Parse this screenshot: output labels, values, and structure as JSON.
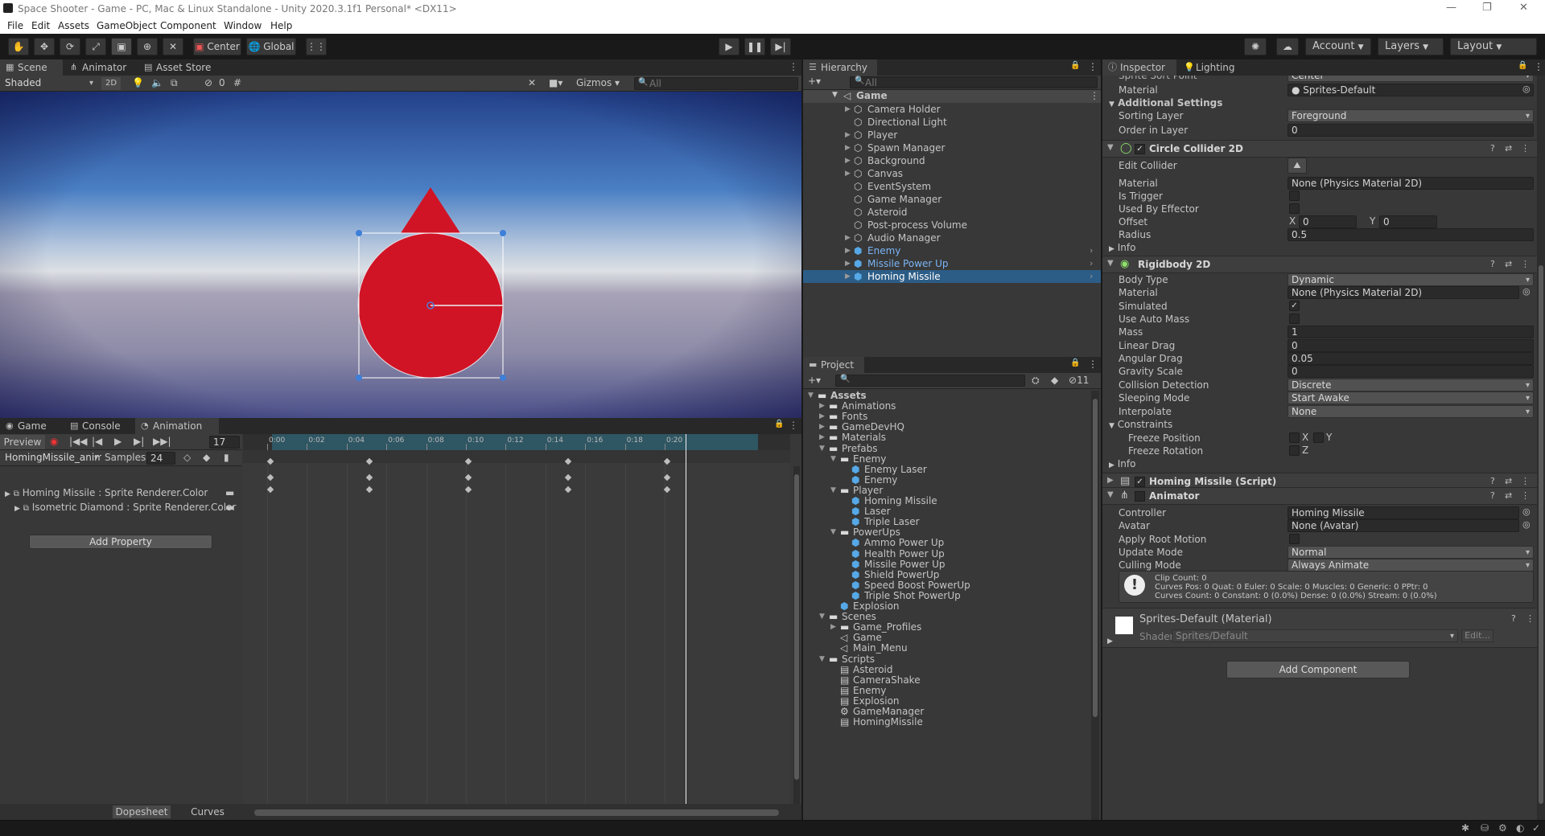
{
  "window": {
    "title": "Space Shooter - Game - PC, Mac & Linux Standalone - Unity 2020.3.1f1 Personal* <DX11>"
  },
  "menu": [
    "File",
    "Edit",
    "Assets",
    "GameObject",
    "Component",
    "Window",
    "Help"
  ],
  "toolbar": {
    "center": "Center",
    "global": "Global",
    "account": "Account",
    "layers": "Layers",
    "layout": "Layout"
  },
  "scene": {
    "tabs": [
      "Scene",
      "Animator",
      "Asset Store"
    ],
    "shading": "Shaded",
    "mode2d": "2D",
    "hidden_count": "0",
    "gizmos": "Gizmos",
    "search_placeholder": "All"
  },
  "bottom": {
    "tabs": [
      "Game",
      "Console",
      "Animation"
    ],
    "preview": "Preview",
    "frame": "17",
    "clip": "HomingMissile_anim",
    "samples_label": "Samples",
    "samples": "24",
    "ruler": [
      "0:00",
      "0:02",
      "0:04",
      "0:06",
      "0:08",
      "0:10",
      "0:12",
      "0:14",
      "0:16",
      "0:18",
      "0:20"
    ],
    "properties": [
      "Homing Missile : Sprite Renderer.Color",
      "Isometric Diamond : Sprite Renderer.Color"
    ],
    "add_property": "Add Property",
    "dopesheet": "Dopesheet",
    "curves": "Curves"
  },
  "hierarchy": {
    "title": "Hierarchy",
    "search_placeholder": "All",
    "root": "Game",
    "items": [
      {
        "name": "Camera Holder",
        "fold": true
      },
      {
        "name": "Directional Light",
        "fold": false
      },
      {
        "name": "Player",
        "fold": true
      },
      {
        "name": "Spawn Manager",
        "fold": true
      },
      {
        "name": "Background",
        "fold": true
      },
      {
        "name": "Canvas",
        "fold": true
      },
      {
        "name": "EventSystem",
        "fold": false
      },
      {
        "name": "Game Manager",
        "fold": false
      },
      {
        "name": "Asteroid",
        "fold": false
      },
      {
        "name": "Post-process Volume",
        "fold": false
      },
      {
        "name": "Audio Manager",
        "fold": true
      },
      {
        "name": "Enemy",
        "fold": true
      },
      {
        "name": "Missile Power Up",
        "fold": true
      },
      {
        "name": "Homing Missile",
        "fold": true
      }
    ]
  },
  "project": {
    "title": "Project",
    "hidden_count": "11",
    "items": [
      {
        "name": "Assets",
        "d": 0,
        "t": "folder",
        "o": true
      },
      {
        "name": "Animations",
        "d": 1,
        "t": "folder"
      },
      {
        "name": "Fonts",
        "d": 1,
        "t": "folder"
      },
      {
        "name": "GameDevHQ",
        "d": 1,
        "t": "folder"
      },
      {
        "name": "Materials",
        "d": 1,
        "t": "folder"
      },
      {
        "name": "Prefabs",
        "d": 1,
        "t": "folder",
        "o": true
      },
      {
        "name": "Enemy",
        "d": 2,
        "t": "folder",
        "o": true
      },
      {
        "name": "Enemy Laser",
        "d": 3,
        "t": "prefab"
      },
      {
        "name": "Enemy",
        "d": 3,
        "t": "prefab"
      },
      {
        "name": "Player",
        "d": 2,
        "t": "folder",
        "o": true
      },
      {
        "name": "Homing Missile",
        "d": 3,
        "t": "prefab"
      },
      {
        "name": "Laser",
        "d": 3,
        "t": "prefab"
      },
      {
        "name": "Triple Laser",
        "d": 3,
        "t": "prefab"
      },
      {
        "name": "PowerUps",
        "d": 2,
        "t": "folder",
        "o": true
      },
      {
        "name": "Ammo Power Up",
        "d": 3,
        "t": "prefab"
      },
      {
        "name": "Health Power Up",
        "d": 3,
        "t": "prefab"
      },
      {
        "name": "Missile Power Up",
        "d": 3,
        "t": "prefab"
      },
      {
        "name": "Shield PowerUp",
        "d": 3,
        "t": "prefab"
      },
      {
        "name": "Speed Boost PowerUp",
        "d": 3,
        "t": "prefab"
      },
      {
        "name": "Triple Shot PowerUp",
        "d": 3,
        "t": "prefab"
      },
      {
        "name": "Explosion",
        "d": 2,
        "t": "prefab"
      },
      {
        "name": "Scenes",
        "d": 1,
        "t": "folder",
        "o": true
      },
      {
        "name": "Game_Profiles",
        "d": 2,
        "t": "folder"
      },
      {
        "name": "Game",
        "d": 2,
        "t": "scene"
      },
      {
        "name": "Main_Menu",
        "d": 2,
        "t": "scene"
      },
      {
        "name": "Scripts",
        "d": 1,
        "t": "folder",
        "o": true
      },
      {
        "name": "Asteroid",
        "d": 2,
        "t": "script"
      },
      {
        "name": "CameraShake",
        "d": 2,
        "t": "script"
      },
      {
        "name": "Enemy",
        "d": 2,
        "t": "script"
      },
      {
        "name": "Explosion",
        "d": 2,
        "t": "script"
      },
      {
        "name": "GameManager",
        "d": 2,
        "t": "gear"
      },
      {
        "name": "HomingMissile",
        "d": 2,
        "t": "script"
      }
    ]
  },
  "inspector": {
    "tabs": [
      "Inspector",
      "Lighting"
    ],
    "sprite_sort_point": {
      "label": "Sprite Sort Point",
      "value": "Center"
    },
    "material": {
      "label": "Material",
      "value": "Sprites-Default"
    },
    "additional_settings": "Additional Settings",
    "sorting_layer": {
      "label": "Sorting Layer",
      "value": "Foreground"
    },
    "order_in_layer": {
      "label": "Order in Layer",
      "value": "0"
    },
    "circle": {
      "title": "Circle Collider 2D",
      "edit": "Edit Collider",
      "material_label": "Material",
      "material": "None (Physics Material 2D)",
      "is_trigger": "Is Trigger",
      "effector": "Used By Effector",
      "offset": "Offset",
      "offset_x": "0",
      "offset_y": "0",
      "radius_label": "Radius",
      "radius": "0.5",
      "info": "Info"
    },
    "rb": {
      "title": "Rigidbody 2D",
      "rows": [
        {
          "label": "Body Type",
          "value": "Dynamic",
          "kind": "dd"
        },
        {
          "label": "Material",
          "value": "None (Physics Material 2D)",
          "kind": "obj"
        },
        {
          "label": "Simulated",
          "value": "✓",
          "kind": "chk"
        },
        {
          "label": "Use Auto Mass",
          "value": "",
          "kind": "chk"
        },
        {
          "label": "Mass",
          "value": "1",
          "kind": "field"
        },
        {
          "label": "Linear Drag",
          "value": "0",
          "kind": "field"
        },
        {
          "label": "Angular Drag",
          "value": "0.05",
          "kind": "field"
        },
        {
          "label": "Gravity Scale",
          "value": "0",
          "kind": "field"
        },
        {
          "label": "Collision Detection",
          "value": "Discrete",
          "kind": "dd"
        },
        {
          "label": "Sleeping Mode",
          "value": "Start Awake",
          "kind": "dd"
        },
        {
          "label": "Interpolate",
          "value": "None",
          "kind": "dd"
        }
      ],
      "constraints": "Constraints",
      "freeze_pos": "Freeze Position",
      "freeze_rot": "Freeze Rotation",
      "x": "X",
      "y": "Y",
      "z": "Z",
      "info": "Info"
    },
    "script": {
      "title": "Homing Missile (Script)"
    },
    "animator": {
      "title": "Animator",
      "rows": [
        {
          "label": "Controller",
          "value": "Homing Missile",
          "kind": "obj"
        },
        {
          "label": "Avatar",
          "value": "None (Avatar)",
          "kind": "obj"
        },
        {
          "label": "Apply Root Motion",
          "value": "",
          "kind": "chk"
        },
        {
          "label": "Update Mode",
          "value": "Normal",
          "kind": "dd"
        },
        {
          "label": "Culling Mode",
          "value": "Always Animate",
          "kind": "dd"
        }
      ],
      "info": [
        "Clip Count: 0",
        "Curves Pos: 0 Quat: 0 Euler: 0 Scale: 0 Muscles: 0 Generic: 0 PPtr: 0",
        "Curves Count: 0 Constant: 0 (0.0%) Dense: 0 (0.0%) Stream: 0 (0.0%)"
      ]
    },
    "material_block": {
      "title": "Sprites-Default (Material)",
      "shader_label": "Shader",
      "shader": "Sprites/Default",
      "edit": "Edit..."
    },
    "add_component": "Add Component"
  },
  "colors": {
    "accent": "#2c5d87",
    "missile": "#d01426",
    "prefab": "#56a8e6"
  }
}
